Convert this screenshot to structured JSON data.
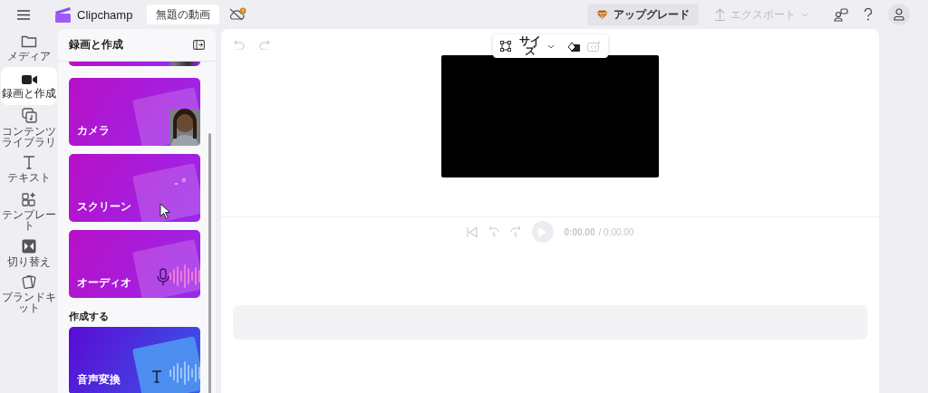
{
  "top_bar": {
    "app_name": "Clipchamp",
    "project_title": "無題の動画",
    "upgrade_button": "アップグレード",
    "export_button": {
      "label": "エクスポート",
      "disabled": true
    }
  },
  "rail": [
    {
      "label": "メディア",
      "selected": false
    },
    {
      "label": "録画と作成",
      "selected": true
    },
    {
      "label": "コンテンツライブラリ",
      "selected": false
    },
    {
      "label": "テキスト",
      "selected": false
    },
    {
      "label": "テンプレート",
      "selected": false
    },
    {
      "label": "切り替え",
      "selected": false
    },
    {
      "label": "ブランドキット",
      "selected": false
    }
  ],
  "panel": {
    "title": "録画と作成",
    "sections": [
      {
        "cards": [
          {
            "kind": "partial"
          },
          {
            "kind": "camera",
            "label": "カメラ"
          },
          {
            "kind": "screen",
            "label": "スクリーン"
          },
          {
            "kind": "audio",
            "label": "オーディオ"
          }
        ]
      },
      {
        "heading": "作成する",
        "cards": [
          {
            "kind": "tts",
            "label": "音声変換"
          }
        ]
      }
    ]
  },
  "stage": {
    "size_button": "サイズ",
    "time_current": "0:00.00",
    "time_total": "/ 0:00.00"
  }
}
